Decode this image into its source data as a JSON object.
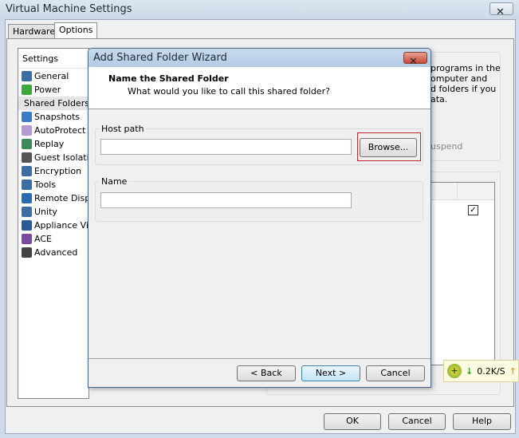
{
  "window": {
    "title": "Virtual Machine Settings",
    "close": "✕"
  },
  "tabs": [
    {
      "label": "Hardware"
    },
    {
      "label": "Options"
    }
  ],
  "settings": {
    "header": "Settings",
    "items": [
      {
        "label": "General",
        "icon": "general-icon",
        "color": "#3a6ea5"
      },
      {
        "label": "Power",
        "icon": "power-icon",
        "color": "#3aa83a"
      },
      {
        "label": "Shared Folders",
        "icon": "folder-icon",
        "color": "#d8c98a"
      },
      {
        "label": "Snapshots",
        "icon": "snapshots-icon",
        "color": "#3a7bc8"
      },
      {
        "label": "AutoProtect",
        "icon": "autoprotect-icon",
        "color": "#b49ad0"
      },
      {
        "label": "Replay",
        "icon": "replay-icon",
        "color": "#3a8a5a"
      },
      {
        "label": "Guest Isolation",
        "icon": "lock-icon",
        "color": "#555555"
      },
      {
        "label": "Encryption",
        "icon": "encryption-icon",
        "color": "#3a6ea5"
      },
      {
        "label": "Tools",
        "icon": "tools-icon",
        "color": "#3a6ea5"
      },
      {
        "label": "Remote Display",
        "icon": "remote-display-icon",
        "color": "#2a6ab0"
      },
      {
        "label": "Unity",
        "icon": "unity-icon",
        "color": "#3a6ea5"
      },
      {
        "label": "Appliance View",
        "icon": "appliance-icon",
        "color": "#2a5a9a"
      },
      {
        "label": "ACE",
        "icon": "ace-icon",
        "color": "#7a4aa0"
      },
      {
        "label": "Advanced",
        "icon": "advanced-icon",
        "color": "#444444"
      }
    ]
  },
  "right_text": {
    "lines": [
      "programs in the",
      "omputer and",
      "d folders if you",
      "ata."
    ],
    "suspend": "uspend"
  },
  "wizard": {
    "title": "Add Shared Folder Wizard",
    "close": "✕",
    "heading": "Name the Shared Folder",
    "subheading": "What would you like to call this shared folder?",
    "host_path_label": "Host path",
    "host_path_value": "",
    "browse": "Browse...",
    "name_label": "Name",
    "name_value": "",
    "back": "< Back",
    "next": "Next >",
    "cancel": "Cancel"
  },
  "footer": {
    "ok": "OK",
    "cancel": "Cancel",
    "help": "Help"
  },
  "tray": {
    "speed": "0.2K/S",
    "down": "↓",
    "up": "↑"
  },
  "colors": {
    "highlight": "#c0272d"
  }
}
